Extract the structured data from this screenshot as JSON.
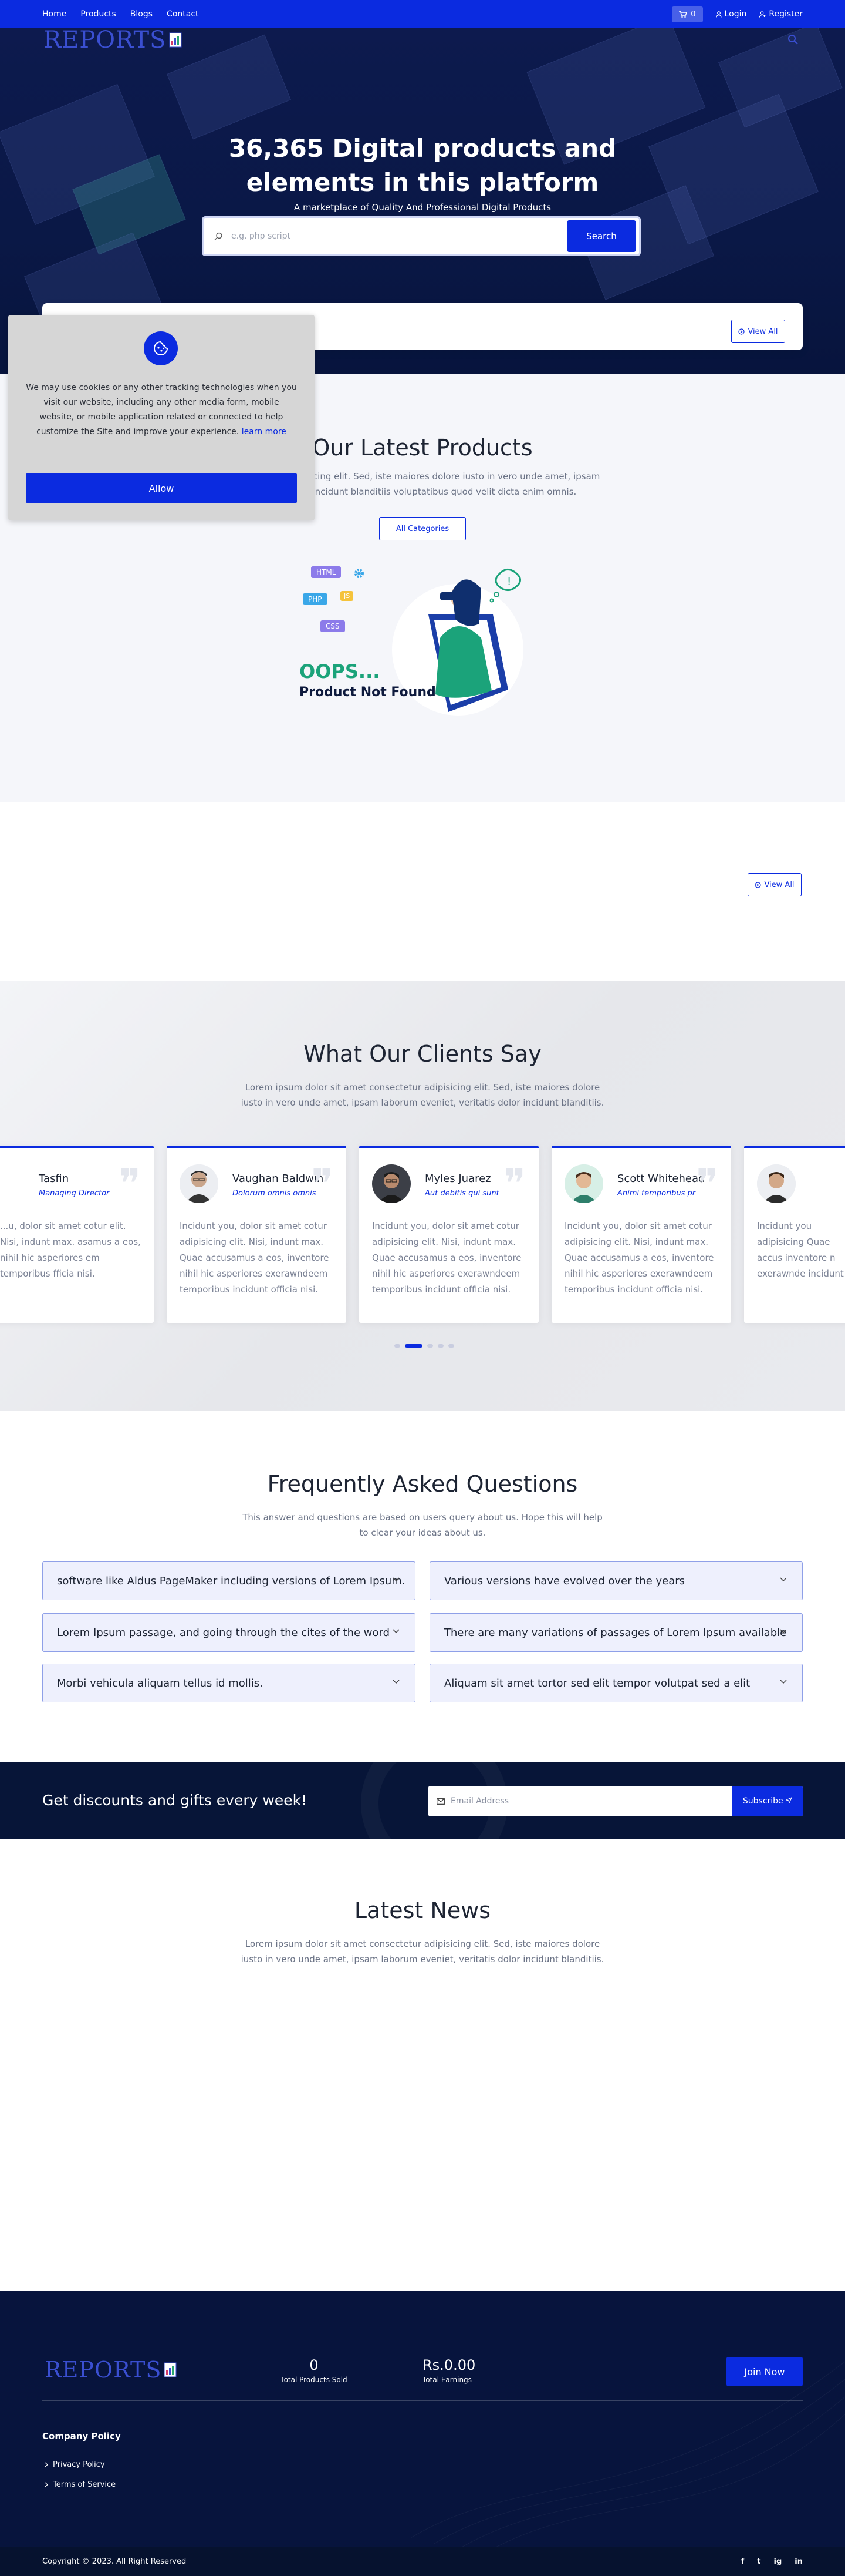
{
  "nav": {
    "links": [
      "Home",
      "Products",
      "Blogs",
      "Contact"
    ],
    "cart_count": "0",
    "login": "Login",
    "register": "Register"
  },
  "brand": {
    "logo_text": "REPORTS"
  },
  "hero": {
    "title_line1": "36,365 Digital products and",
    "title_line2": "elements in this platform",
    "subtitle": "A marketplace of Quality And Professional Digital Products",
    "search_placeholder": "e.g. php script",
    "search_button": "Search",
    "view_all": "View All"
  },
  "cookie": {
    "text": "We may use cookies or any other tracking technologies when you visit our website, including any other media form, mobile website, or mobile application related or connected to help customize the Site and improve your experience.",
    "learn_more": "learn more",
    "allow": "Allow"
  },
  "products": {
    "title": "Our Latest Products",
    "desc_line1": "sectetur adipisicing elit. Sed, iste maiores dolore iusto in vero unde amet, ipsam",
    "desc_line2": "atis dolor incidunt blanditiis voluptatibus quod velit dicta enim omnis.",
    "all_categories": "All Categories",
    "empty_title": "OOPS...",
    "empty_sub": "Product Not Found",
    "tags": [
      "HTML",
      "PHP",
      "JS",
      "CSS"
    ]
  },
  "featured": {
    "view_all": "View All"
  },
  "testimonials": {
    "title": "What Our Clients Say",
    "desc_line1": "Lorem ipsum dolor sit amet consectetur adipisicing elit. Sed, iste maiores dolore",
    "desc_line2": "iusto in vero unde amet, ipsam laborum eveniet, veritatis dolor incidunt blanditiis.",
    "cards": [
      {
        "name": "Tasfin",
        "role": "Managing Director",
        "text": "...u, dolor sit amet cotur elit. Nisi, indunt max. asamus a eos, nihil hic asperiores em temporibus fficia nisi."
      },
      {
        "name": "Vaughan Baldwin",
        "role": "Dolorum omnis omnis",
        "text": "Incidunt you, dolor sit amet cotur adipisicing elit. Nisi, indunt max. Quae accusamus a eos, inventore nihil hic asperiores exerawndeem temporibus incidunt officia nisi."
      },
      {
        "name": "Myles Juarez",
        "role": "Aut debitis qui sunt",
        "text": "Incidunt you, dolor sit amet cotur adipisicing elit. Nisi, indunt max. Quae accusamus a eos, inventore nihil hic asperiores exerawndeem temporibus incidunt officia nisi."
      },
      {
        "name": "Scott Whitehead",
        "role": "Animi temporibus pr",
        "text": "Incidunt you, dolor sit amet cotur adipisicing elit. Nisi, indunt max. Quae accusamus a eos, inventore nihil hic asperiores exerawndeem temporibus incidunt officia nisi."
      },
      {
        "name": "",
        "role": "",
        "text": "Incidunt you adipisicing Quae accus inventore n exerawnde incidunt"
      }
    ]
  },
  "faq": {
    "title": "Frequently Asked Questions",
    "desc_line1": "This answer and questions are based on users query about us. Hope this will help",
    "desc_line2": "to clear your ideas about us.",
    "items": [
      "software like Aldus PageMaker including versions of Lorem Ipsum.",
      "Various versions have evolved over the years",
      "Lorem Ipsum passage, and going through the cites of the word",
      "There are many variations of passages of Lorem Ipsum available",
      "Morbi vehicula aliquam tellus id mollis.",
      "Aliquam sit amet tortor sed elit tempor volutpat sed a elit"
    ]
  },
  "newsletter": {
    "heading": "Get discounts and gifts every week!",
    "placeholder": "Email Address",
    "button": "Subscribe"
  },
  "news": {
    "title": "Latest News",
    "desc_line1": "Lorem ipsum dolor sit amet consectetur adipisicing elit. Sed, iste maiores dolore",
    "desc_line2": "iusto in vero unde amet, ipsam laborum eveniet, veritatis dolor incidunt blanditiis."
  },
  "footer": {
    "products_sold": "0",
    "products_sold_label": "Total Products Sold",
    "earnings": "Rs.0.00",
    "earnings_label": "Total Earnings",
    "join": "Join Now",
    "policy_heading": "Company Policy",
    "policy_links": [
      "Privacy Policy",
      "Terms of Service"
    ],
    "copyright": "Copyright © 2023. All Right Reserved",
    "social": [
      "f",
      "t",
      "ig",
      "in"
    ]
  },
  "colors": {
    "primary": "#0b2be0",
    "hero_bg": "#0d1a4e",
    "footer_bg": "#07143d",
    "accent_green": "#1ba37a"
  }
}
